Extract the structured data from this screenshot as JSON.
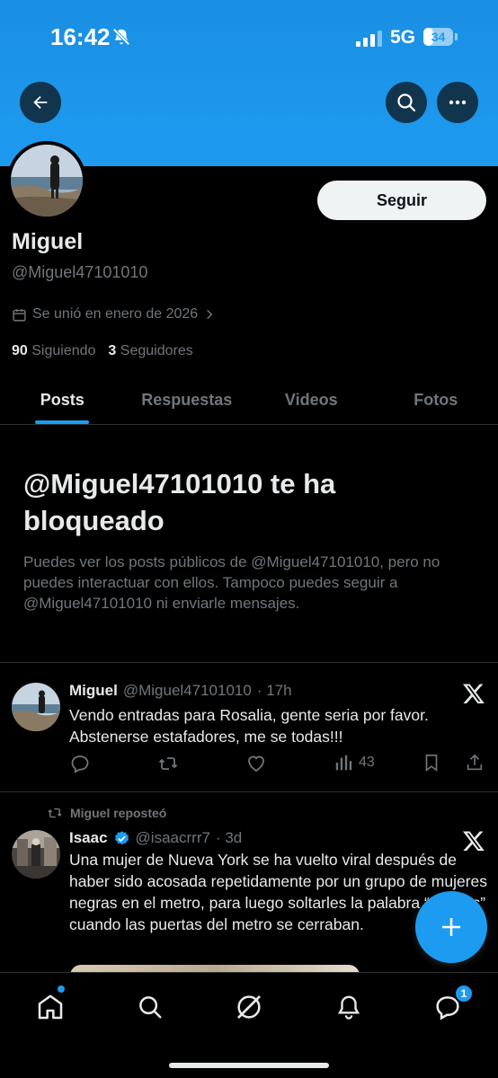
{
  "status": {
    "time": "16:42",
    "network": "5G",
    "battery": "34",
    "battery_level": 0.34
  },
  "profile": {
    "follow_label": "Seguir",
    "name": "Miguel",
    "handle": "@Miguel47101010",
    "joined": "Se unió en enero de 2026",
    "following_count": "90",
    "following_label": "Siguiendo",
    "followers_count": "3",
    "followers_label": "Seguidores"
  },
  "tabs": [
    {
      "label": "Posts"
    },
    {
      "label": "Respuestas"
    },
    {
      "label": "Videos"
    },
    {
      "label": "Fotos"
    }
  ],
  "blocked": {
    "title": "@Miguel47101010 te ha bloqueado",
    "body": "Puedes ver los posts públicos de @Miguel47101010, pero no puedes interactuar con ellos. Tampoco puedes seguir a @Miguel47101010 ni enviarle mensajes."
  },
  "posts": [
    {
      "name": "Miguel",
      "handle": "@Miguel47101010",
      "time": "· 17h",
      "text": "Vendo entradas para Rosalia, gente seria por favor. Abstenerse estafadores, me se todas!!!",
      "views": "43"
    },
    {
      "repost_label": "Miguel reposteó",
      "name": "Isaac",
      "handle": "@isaacrrr7",
      "time": "· 3d",
      "text": "Una mujer de Nueva York se ha vuelto viral después de haber sido acosada repetidamente por un grupo de mujeres negras en el metro, para luego soltarles la palabra “Negras” cuando las puertas del metro se cerraban."
    }
  ],
  "nav": {
    "messages_badge": "1"
  },
  "colors": {
    "accent": "#1d9bf0",
    "background": "#000000",
    "muted": "#71767b",
    "text": "#e7e9ea"
  }
}
